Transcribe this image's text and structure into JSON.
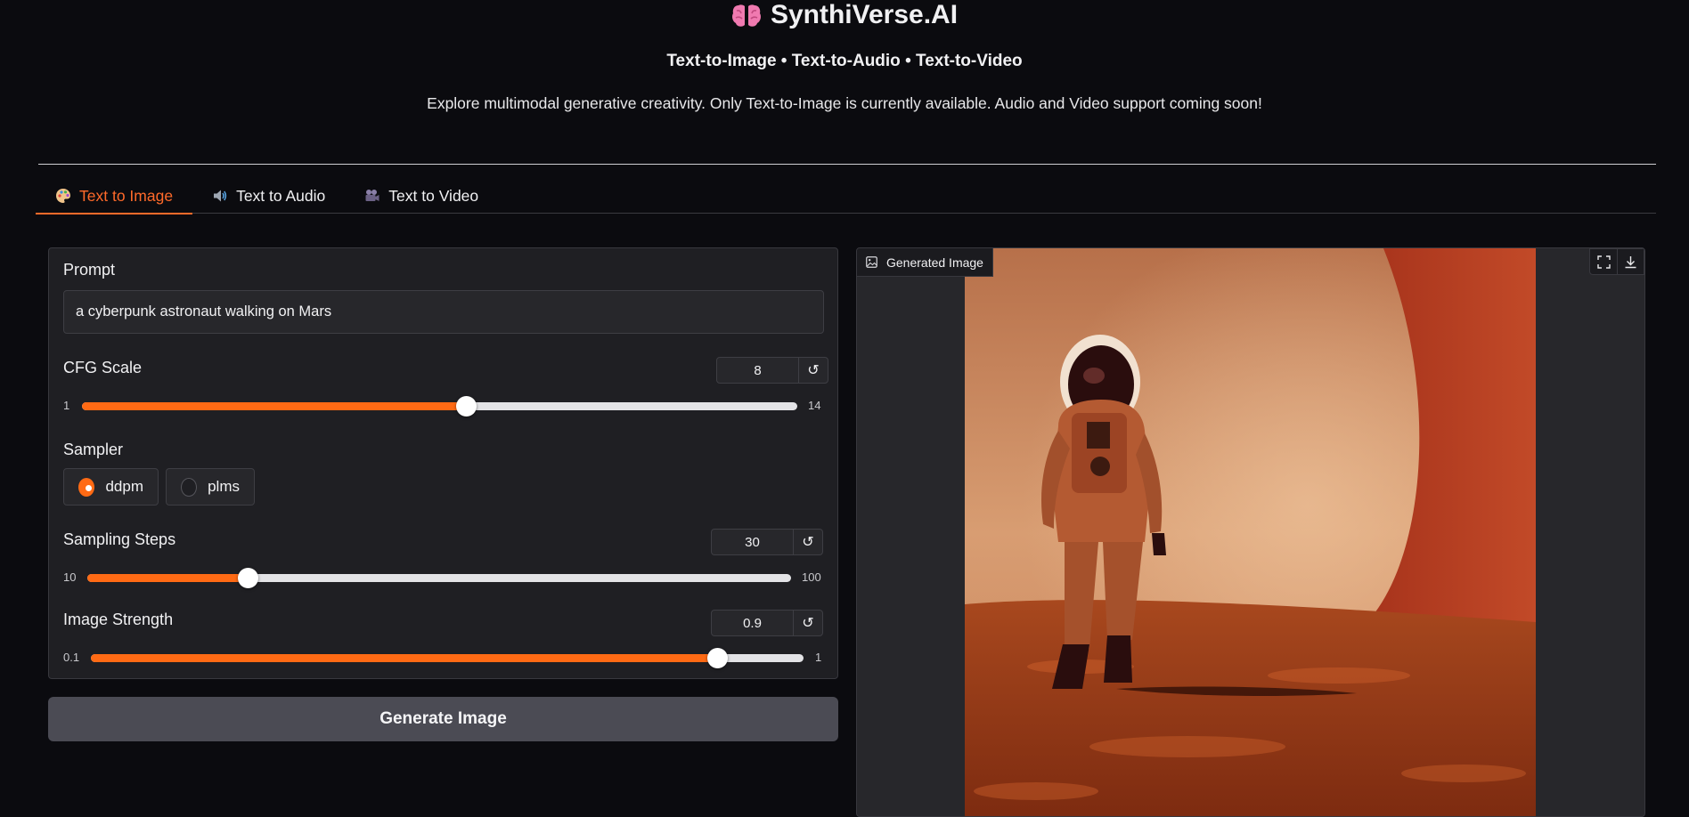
{
  "header": {
    "title": "SynthiVerse.AI",
    "subtitle": "Text-to-Image • Text-to-Audio • Text-to-Video",
    "description": "Explore multimodal generative creativity. Only Text-to-Image is currently available. Audio and Video support coming soon!"
  },
  "tabs": [
    {
      "label": "Text to Image",
      "icon": "palette-icon",
      "active": true
    },
    {
      "label": "Text to Audio",
      "icon": "speaker-icon",
      "active": false
    },
    {
      "label": "Text to Video",
      "icon": "camera-icon",
      "active": false
    }
  ],
  "form": {
    "prompt": {
      "label": "Prompt",
      "value": "a cyberpunk astronaut walking on Mars"
    },
    "cfg_scale": {
      "label": "CFG Scale",
      "value": "8",
      "min": "1",
      "max": "14"
    },
    "sampler": {
      "label": "Sampler",
      "options": [
        "ddpm",
        "plms"
      ],
      "selected": "ddpm"
    },
    "sampling_steps": {
      "label": "Sampling Steps",
      "value": "30",
      "min": "10",
      "max": "100"
    },
    "image_strength": {
      "label": "Image Strength",
      "value": "0.9",
      "min": "0.1",
      "max": "1"
    },
    "reset_symbol": "↺"
  },
  "generate_button": "Generate Image",
  "output": {
    "label": "Generated Image",
    "image_icon": "image-icon",
    "fullscreen_icon": "fullscreen-icon",
    "download_icon": "download-icon"
  },
  "colors": {
    "accent": "#ff6a14",
    "background": "#0b0b0f",
    "panel": "#1f1f23"
  }
}
